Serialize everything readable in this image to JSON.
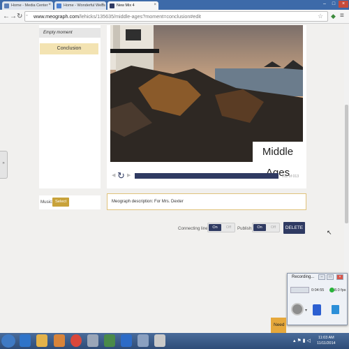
{
  "browser": {
    "tabs": [
      {
        "label": "Home - Media Center"
      },
      {
        "label": "Home - Wonderful Webs"
      },
      {
        "label": "New Mix 4"
      }
    ],
    "url_prefix": "www.meograph.com",
    "url_path": "/lehicks/135635/middle-ages?moment=conclusion#edit"
  },
  "sidebar": {
    "items": [
      {
        "label": "Empty moment"
      },
      {
        "label": "Conclusion"
      }
    ]
  },
  "player": {
    "title": "Middle Ages",
    "counter": "011 of 013"
  },
  "music": {
    "label": "Music:",
    "select_label": "Select"
  },
  "description": {
    "value": "Meograph description: For Mrs. Dexter"
  },
  "controls": {
    "connecting_label": "Connecting lines:",
    "publish_label": "Publish:",
    "on_label": "On",
    "off_label": "Off",
    "delete_label": "DELETE"
  },
  "recorder": {
    "title": "Recording...",
    "elapsed": "0:04:55",
    "fps": "8.0 fps"
  },
  "help": {
    "label": "Need h"
  },
  "taskbar": {
    "time": "11:03 AM",
    "date": "11/11/2014"
  },
  "colors": {
    "accent_navy": "#2f3a62",
    "select_gold": "#c8a23a",
    "highlight": "#f3e3b2",
    "tab_blue": "#3d6aa9"
  }
}
